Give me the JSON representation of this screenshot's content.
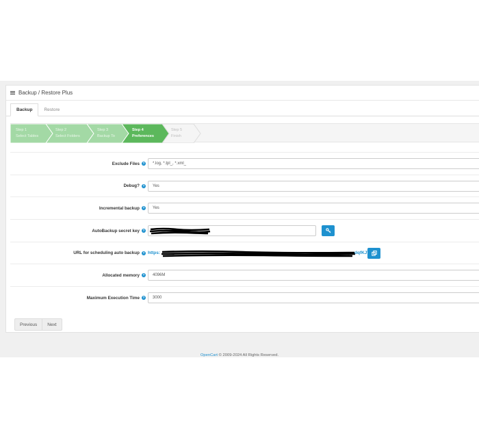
{
  "panel": {
    "title": "Backup / Restore Plus"
  },
  "tabs": [
    {
      "label": "Backup",
      "active": true
    },
    {
      "label": "Restore",
      "active": false
    }
  ],
  "wizard": {
    "colors": {
      "done": "#a3d9a5",
      "current": "#5cb85c",
      "todo": "#f5f5f5"
    },
    "steps": [
      {
        "title": "Step 1",
        "subtitle": "Select Tables",
        "state": "done"
      },
      {
        "title": "Step 2",
        "subtitle": "Select Folders",
        "state": "done"
      },
      {
        "title": "Step 3",
        "subtitle": "Backup To",
        "state": "done"
      },
      {
        "title": "Step 4",
        "subtitle": "Preferences",
        "state": "current"
      },
      {
        "title": "Step 5",
        "subtitle": "Finish",
        "state": "todo"
      }
    ]
  },
  "form": {
    "exclude_files": {
      "label": "Exclude Files",
      "value": "*.log, *.tpl_, *.xml_"
    },
    "debug": {
      "label": "Debug?",
      "value": "Yes"
    },
    "incremental": {
      "label": "Incremental backup",
      "value": "Yes"
    },
    "secret_key": {
      "label": "AutoBackup secret key",
      "value": "",
      "button_icon": "key-icon"
    },
    "schedule_url": {
      "label": "URL for scheduling auto backup",
      "url_start": "https:",
      "url_end": "dqfKJV",
      "button_icon": "copy-icon"
    },
    "memory": {
      "label": "Allocated memory",
      "value": "4096M"
    },
    "exec_time": {
      "label": "Maximum Execution Time",
      "value": "3000"
    }
  },
  "pager": {
    "previous": "Previous",
    "next": "Next"
  },
  "footer": {
    "link": "OpenCart",
    "text": " © 2009-2024 All Rights Reserved."
  },
  "help_icon": "question-circle-icon"
}
